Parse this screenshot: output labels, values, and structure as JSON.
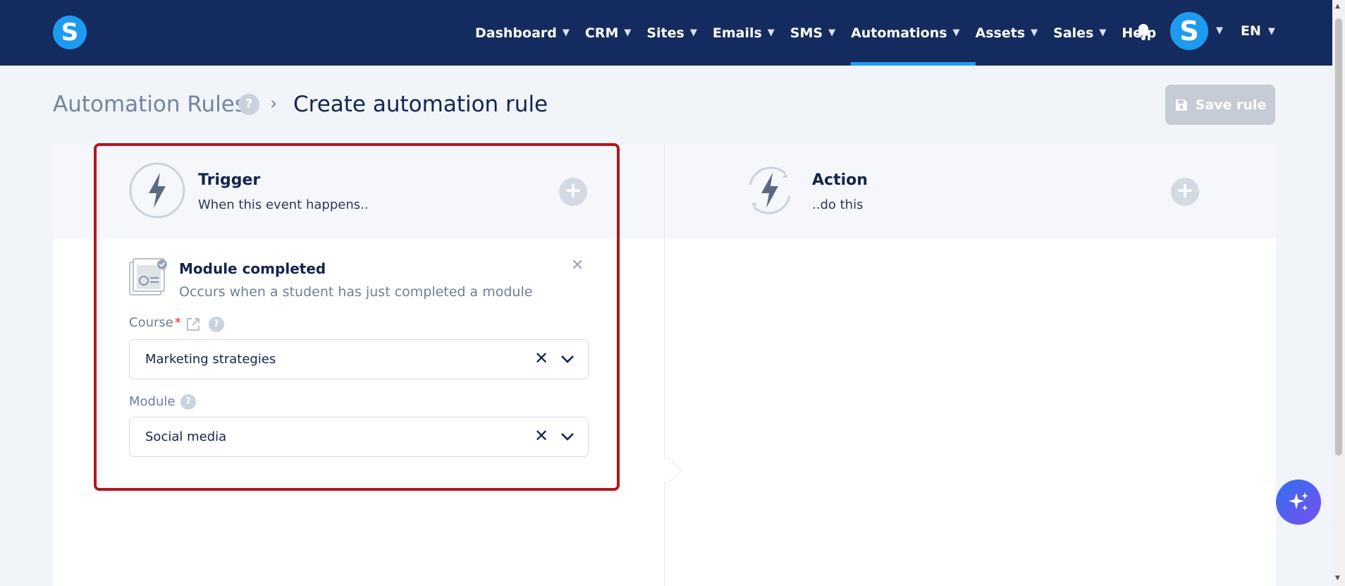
{
  "nav": {
    "items": [
      {
        "label": "Dashboard",
        "has_dropdown": true,
        "active": false
      },
      {
        "label": "CRM",
        "has_dropdown": true,
        "active": false
      },
      {
        "label": "Sites",
        "has_dropdown": true,
        "active": false
      },
      {
        "label": "Emails",
        "has_dropdown": true,
        "active": false
      },
      {
        "label": "SMS",
        "has_dropdown": true,
        "active": false
      },
      {
        "label": "Automations",
        "has_dropdown": true,
        "active": true
      },
      {
        "label": "Assets",
        "has_dropdown": true,
        "active": false
      },
      {
        "label": "Sales",
        "has_dropdown": true,
        "active": false
      },
      {
        "label": "Help",
        "has_dropdown": false,
        "active": false
      }
    ],
    "logo_letter": "S",
    "avatar_letter": "S",
    "language": "EN",
    "bell_icon": "bell-icon"
  },
  "header": {
    "breadcrumb_parent": "Automation Rules",
    "help_glyph": "?",
    "separator": "›",
    "title": "Create automation rule",
    "save_label": "Save rule"
  },
  "trigger": {
    "title": "Trigger",
    "subtitle": "When this event happens..",
    "add_glyph": "+",
    "module": {
      "title": "Module completed",
      "description": "Occurs when a student has just completed a module",
      "close_glyph": "✕"
    },
    "course_field": {
      "label": "Course",
      "required_mark": "*",
      "value": "Marketing strategies",
      "clear_glyph": "✕"
    },
    "module_field": {
      "label": "Module",
      "value": "Social media",
      "clear_glyph": "✕"
    }
  },
  "action": {
    "title": "Action",
    "subtitle": "..do this",
    "add_glyph": "+"
  },
  "colors": {
    "nav_bg": "#132b5e",
    "accent": "#1d9bf0",
    "highlight_border": "#b4161c"
  }
}
